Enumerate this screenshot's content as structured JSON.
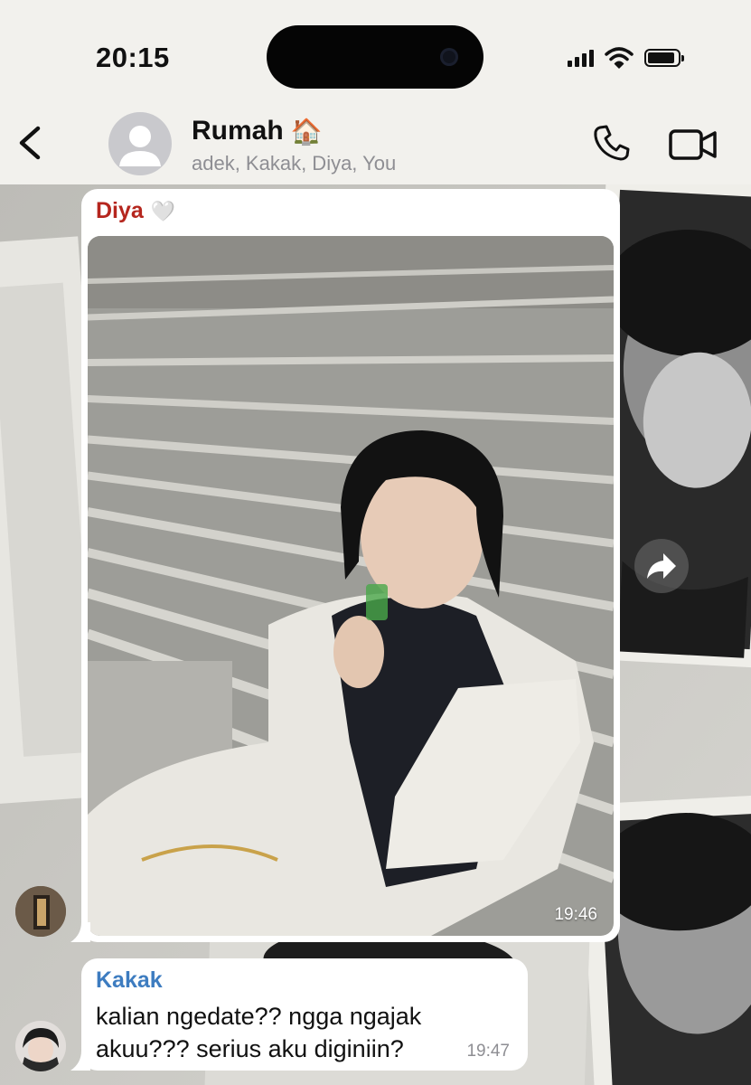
{
  "status_bar": {
    "time": "20:15",
    "icons": [
      "cellular-signal-icon",
      "wifi-icon",
      "battery-icon"
    ]
  },
  "header": {
    "title": "Rumah",
    "title_emoji": "🏠",
    "members": "adek, Kakak, Diya, You",
    "icons": [
      "back-chevron-icon",
      "group-avatar-icon",
      "phone-icon",
      "video-camera-icon"
    ]
  },
  "messages": [
    {
      "type": "photo",
      "sender": "Diya",
      "sender_emoji": "🤍",
      "time": "19:46",
      "sender_color": "#b5261e"
    },
    {
      "type": "text",
      "sender": "Kakak",
      "text": "kalian ngedate?? ngga ngajak akuu??? serius aku diginiin?",
      "time": "19:47",
      "sender_color": "#3d7cc0"
    }
  ],
  "actions": {
    "forward_icon": "forward-arrow-icon"
  },
  "colors": {
    "bar_background": "#f2f1ed",
    "bubble": "#ffffff",
    "secondary_text": "#8e8e93"
  }
}
